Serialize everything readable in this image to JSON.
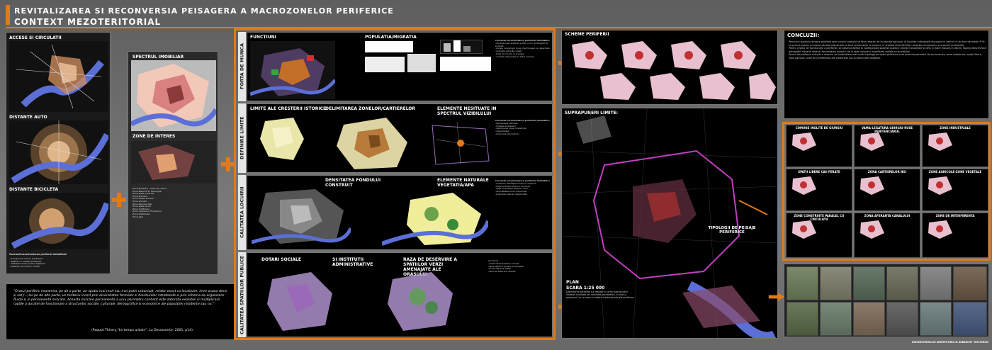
{
  "header": {
    "title": "REVITALIZAREA SI RECONVERSIA PEISAGERA A MACROZONELOR PERIFERICE",
    "subtitle": "CONTEXT MEZOTERITORIAL"
  },
  "left": {
    "accese": "ACCESE SI CIRCULATII",
    "auto": "DISTANTE AUTO",
    "bicicleta": "DISTANTE BICICLETA",
    "caption": "Concluzii-caracterizarea periferiei delimitate:"
  },
  "spectrum": {
    "title": "SPECTRUL IMOBILIAR",
    "zone": "ZONE DE INTERES"
  },
  "quote": {
    "text": "\"Orasul periferic inseamna, pe de o parte, un spatiu mai mult sau mai putin urbanizat, relativ exact ca localizare, intre orasul dens si sat,(...)iar pe de alta parte, un teritoriu incert prin diversitatea formelor si functiunilor intretesute si prin schema de organizare fluida si in permanenta miscare. Aceasta miscare permanenta a unui perimetru contient este datorata evolutiei si multiplicarii rapide a duratei de functionare a structurilor sociale, culturale, demografice si economice ale populatiei rezidente sau nu.\"",
    "source": "(Paquot Thierry,\"Le temps urbain\". La Decouverte, 2001, p14)"
  },
  "middle": {
    "labels": [
      "FORTA DE MUNCA",
      "DEFINIRE LIMITE",
      "CALITATEA LOCUIRII",
      "CALITATEA SPATIILOR PUBLICE"
    ],
    "functiuni": "FUNCTIUNI",
    "populatia": "POPULATIA/MIGRATIA",
    "limite": "LIMITE ALE CRESTERII ISTORICE",
    "delimitarea": "DELIMITAREA ZONELOR/CARTIERELOR",
    "elemente": "ELEMENTE NESITUATE IN SPECTRUL VIZIBILULUI",
    "densitatea": "DENSITATEA FONDULUI CONSTRUIT",
    "naturale": "ELEMENTE NATURALE VEGETATIA/APA",
    "dotari": "DOTARI SOCIALE",
    "institutii": "SI INSTITUTII ADMINISTRATIVE",
    "raza": "RAZA DE DESERVIRE A SPATIILOR VERZI AMENAJATE ALE ORASULUI",
    "concluzii": "Concluzii-caracterizarea periferiei delimitate:"
  },
  "right": {
    "scheme": "SCHEME PERIFERII",
    "suprapuneri": "SUPRAPUNERI LIMITE:",
    "tipologii": "TIPOLOGII DE PEISAJE PERIFERICE",
    "plan": "PLAN",
    "scara": "SCARA 1:25 000",
    "concluzii_title": "CONCLUZII:",
    "zones": [
      "COMUNE INGLITE DE GIURGIU",
      "VAMA-LEGATURA GIURGIU-RUSE PENITENCIARUL",
      "ZONE INDUSTRIALE",
      "SPATII LIBERE CAII FERATE",
      "ZONA CARTIERELOR NOI",
      "ZONE AGRICOLE-ZONE VEGETALE",
      "ZONE CONSTRUITE PARALEL CU CIRCULATII",
      "ZONA AFERANTA CANALULUI",
      "ZONE DE INTERFERENTA"
    ],
    "university": "UNIVERSITATEA DE ARHITECTURA SI URBANISM \"ION MINCU\""
  },
  "colors": {
    "accent": "#e07a1c",
    "panel": "#000000",
    "bg": "#6b6b6b"
  }
}
